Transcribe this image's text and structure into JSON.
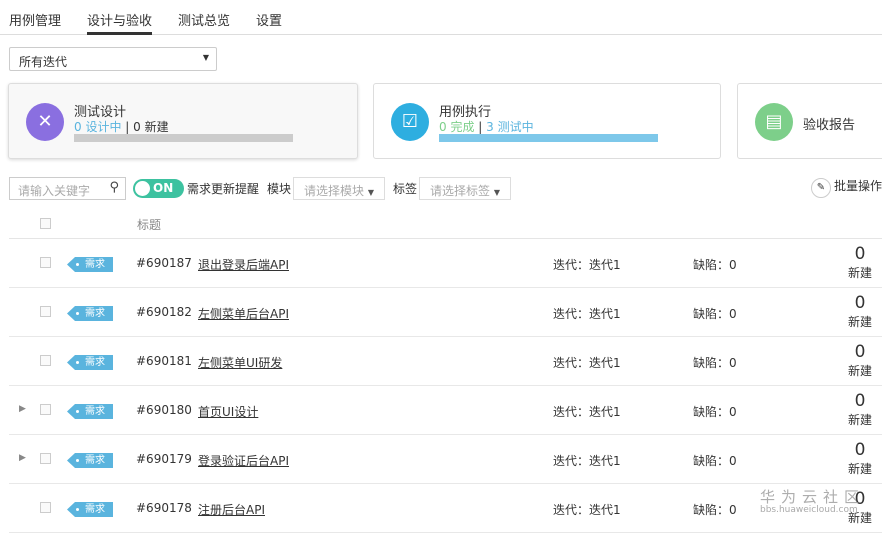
{
  "tabs": [
    "用例管理",
    "设计与验收",
    "测试总览",
    "设置"
  ],
  "iteration_select": "所有迭代",
  "cards": [
    {
      "title": "测试设计",
      "stat1": "0 设计中",
      "stat2": "0 新建",
      "color": "#8a6fe0",
      "progress": 0
    },
    {
      "title": "用例执行",
      "stat1": "0 完成",
      "stat2": "3 测试中",
      "color": "#2eaee0",
      "progress": 1
    },
    {
      "title": "验收报告",
      "color": "#7dcf8a"
    }
  ],
  "toolbar": {
    "search_placeholder": "请输入关键字",
    "toggle": "ON",
    "toggle_label": "需求更新提醒",
    "module_label": "模块",
    "module_placeholder": "请选择模块",
    "tag_label": "标签",
    "tag_placeholder": "请选择标签",
    "batch": "批量操作"
  },
  "table": {
    "header_title": "标题",
    "rows": [
      {
        "tag": "需求",
        "id": "#690187",
        "title": "退出登录后端API",
        "iteration": "迭代：迭代1",
        "defects": "缺陷：0",
        "count": "0",
        "count_label": "新建",
        "expandable": false
      },
      {
        "tag": "需求",
        "id": "#690182",
        "title": "左侧菜单后台API",
        "iteration": "迭代：迭代1",
        "defects": "缺陷：0",
        "count": "0",
        "count_label": "新建",
        "expandable": false
      },
      {
        "tag": "需求",
        "id": "#690181",
        "title": "左侧菜单UI研发",
        "iteration": "迭代：迭代1",
        "defects": "缺陷：0",
        "count": "0",
        "count_label": "新建",
        "expandable": false
      },
      {
        "tag": "需求",
        "id": "#690180",
        "title": "首页UI设计",
        "iteration": "迭代：迭代1",
        "defects": "缺陷：0",
        "count": "0",
        "count_label": "新建",
        "expandable": true
      },
      {
        "tag": "需求",
        "id": "#690179",
        "title": "登录验证后台API",
        "iteration": "迭代：迭代1",
        "defects": "缺陷：0",
        "count": "0",
        "count_label": "新建",
        "expandable": true
      },
      {
        "tag": "需求",
        "id": "#690178",
        "title": "注册后台API",
        "iteration": "迭代：迭代1",
        "defects": "缺陷：0",
        "count": "0",
        "count_label": "新建",
        "expandable": false
      }
    ]
  },
  "watermark": {
    "name": "华为云社区",
    "url": "bbs.huaweicloud.com"
  }
}
